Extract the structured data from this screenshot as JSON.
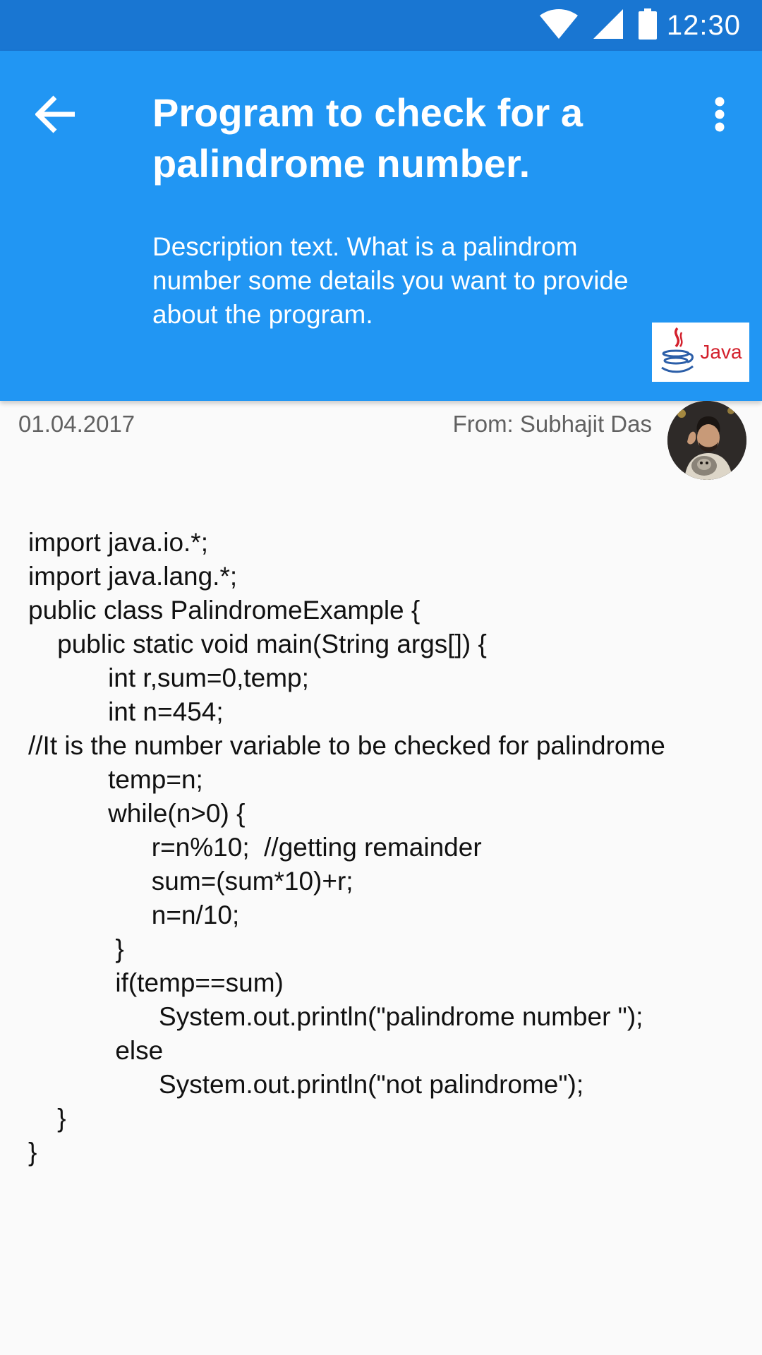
{
  "status_bar": {
    "time": "12:30",
    "icons": [
      "wifi-icon",
      "signal-icon",
      "battery-icon"
    ]
  },
  "app_bar": {
    "title": "Program to check for a palindrome number.",
    "description": "Description text. What is a palindrom number some details you want to provide about the program.",
    "badge_label": "Java",
    "colors": {
      "status_bar": "#1976d2",
      "app_bar": "#2196f3",
      "badge_text": "#d3202c"
    }
  },
  "meta": {
    "date": "01.04.2017",
    "author": "From: Subhajit Das"
  },
  "code_lines": [
    "import java.io.*;",
    "import java.lang.*;",
    "public class PalindromeExample {",
    "    public static void main(String args[]) {",
    "           int r,sum=0,temp;",
    "           int n=454;",
    "//It is the number variable to be checked for palindrome",
    "           temp=n;",
    "           while(n>0) {",
    "                 r=n%10;  //getting remainder",
    "                 sum=(sum*10)+r;",
    "                 n=n/10;",
    "            }",
    "            if(temp==sum)",
    "                  System.out.println(\"palindrome number \");",
    "            else",
    "                  System.out.println(\"not palindrome\");",
    "    }",
    "}"
  ]
}
